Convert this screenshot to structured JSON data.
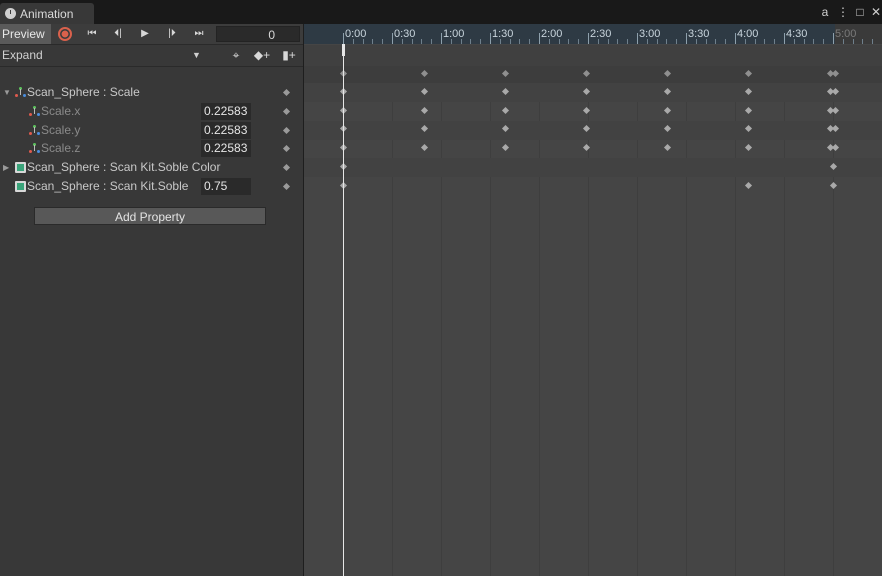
{
  "window": {
    "tab_title": "Animation",
    "icons": [
      "clock-icon",
      "lock-icon",
      "kebab-menu-icon",
      "maximize-icon",
      "close-icon"
    ]
  },
  "toolbar": {
    "preview_label": "Preview",
    "record_color": "#d9614c",
    "buttons": [
      "record-icon",
      "first-key-icon",
      "prev-key-icon",
      "play-icon",
      "next-key-icon",
      "last-key-icon"
    ],
    "frame_value": "0"
  },
  "filter": {
    "mode_label": "Expand",
    "buttons": [
      "filter-by-selection-icon",
      "add-keyframe-icon",
      "add-event-icon"
    ]
  },
  "properties": [
    {
      "label": "Scan_Sphere : Scale",
      "value": "",
      "kind": "scale",
      "child": false
    },
    {
      "label": "Scale.x",
      "value": "0.22583",
      "kind": "scale",
      "child": true
    },
    {
      "label": "Scale.y",
      "value": "0.22583",
      "kind": "scale",
      "child": true
    },
    {
      "label": "Scale.z",
      "value": "0.22583",
      "kind": "scale",
      "child": true
    },
    {
      "label": "Scan_Sphere : Scan Kit.Soble Color",
      "value": "",
      "kind": "material",
      "child": false
    },
    {
      "label": "Scan_Sphere : Scan Kit.Soble",
      "value": "0.75",
      "kind": "material",
      "child": false
    }
  ],
  "add_property_label": "Add Property",
  "timeline": {
    "ticks": [
      "0:00",
      "0:30",
      "1:00",
      "1:30",
      "2:00",
      "2:30",
      "3:00",
      "3:30",
      "4:00",
      "4:30",
      "5:00"
    ],
    "playhead_time": "0:00",
    "accent": "#2e3a44"
  }
}
